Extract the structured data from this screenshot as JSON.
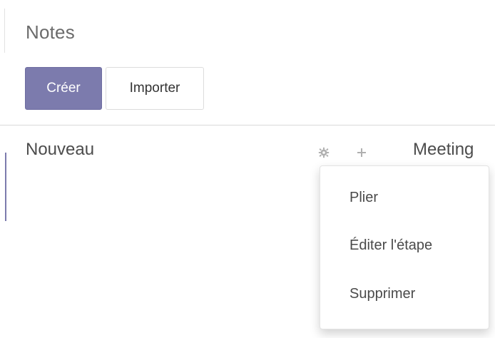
{
  "breadcrumb": {
    "title": "Notes"
  },
  "buttons": {
    "create_label": "Créer",
    "import_label": "Importer"
  },
  "kanban": {
    "columns": [
      {
        "title": "Nouveau"
      },
      {
        "title": "Meeting"
      }
    ],
    "column_icons": {
      "settings": "gear-icon",
      "add": "plus-icon"
    }
  },
  "column_menu": {
    "items": [
      {
        "label": "Plier"
      },
      {
        "label": "Éditer l'étape"
      },
      {
        "label": "Supprimer"
      }
    ]
  },
  "colors": {
    "primary": "#7c7bad",
    "text": "#4c4c4c",
    "muted_icon": "#b0b0b0"
  }
}
